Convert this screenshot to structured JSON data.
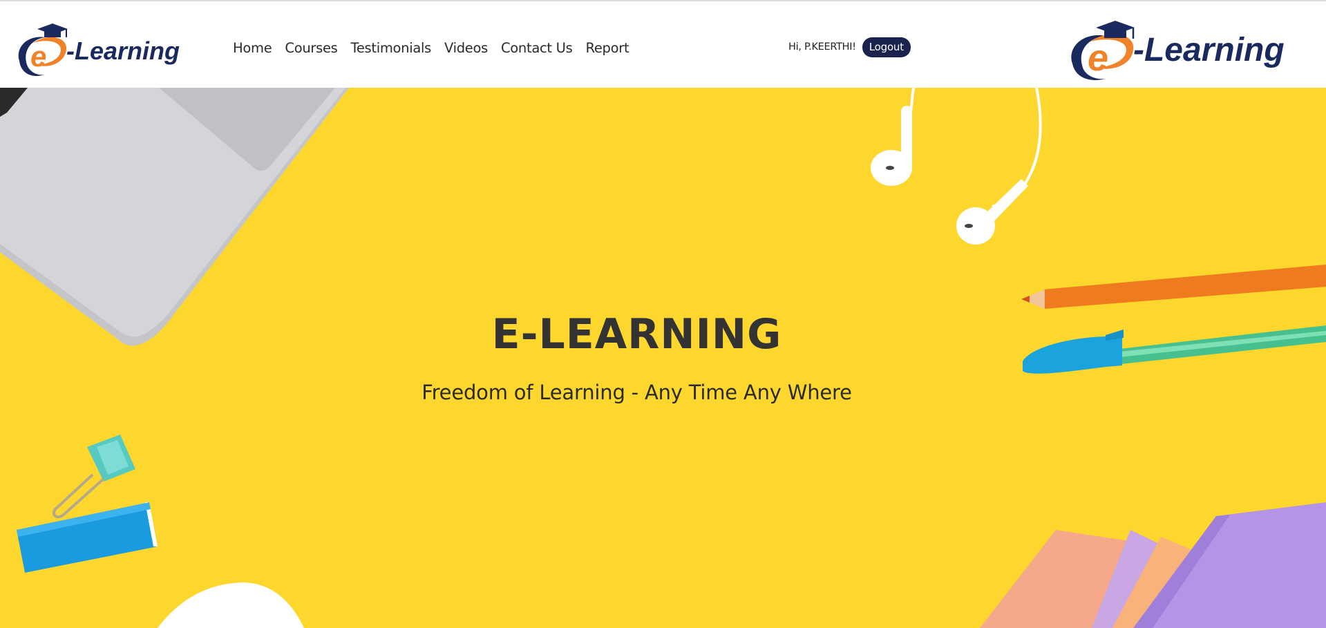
{
  "brand": {
    "logo_text": "-Learning",
    "logo_letter": "e"
  },
  "nav": {
    "items": [
      {
        "label": "Home"
      },
      {
        "label": "Courses"
      },
      {
        "label": "Testimonials"
      },
      {
        "label": "Videos"
      },
      {
        "label": "Contact Us"
      },
      {
        "label": "Report"
      }
    ]
  },
  "user": {
    "greeting": "Hi, P.KEERTHI!",
    "logout_label": "Logout"
  },
  "hero": {
    "title": "E-LEARNING",
    "subtitle": "Freedom of Learning - Any Time Any Where"
  },
  "colors": {
    "hero_background": "#fdd62e",
    "brand_navy": "#1b2a5e",
    "brand_orange": "#f0822a",
    "logout_button": "#1a2350"
  },
  "icons": {
    "logo_cap": "graduation-cap-icon"
  }
}
